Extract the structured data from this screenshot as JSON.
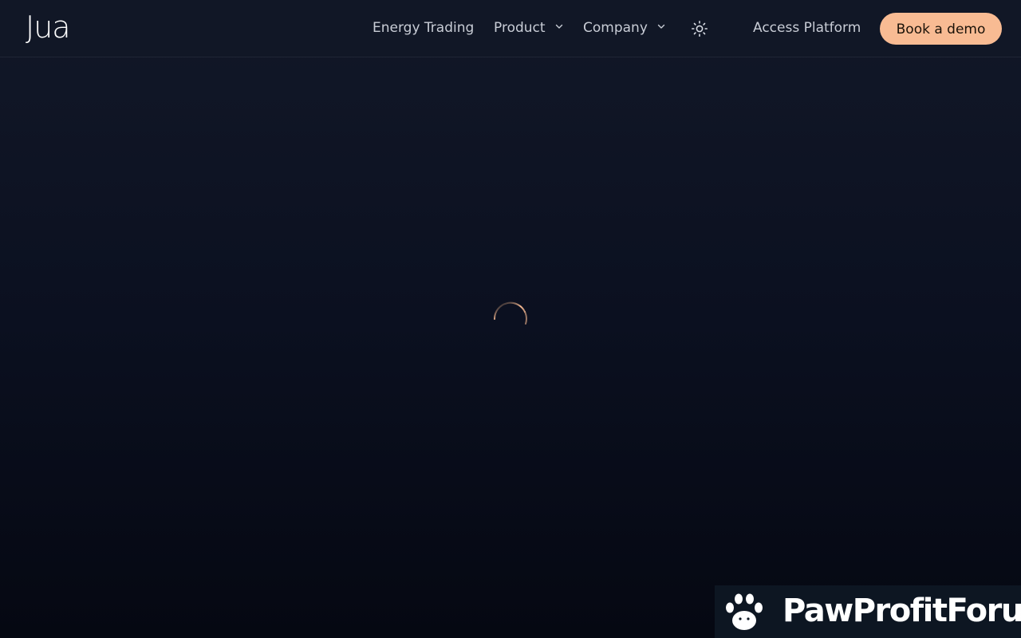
{
  "header": {
    "logo_text": "Jua",
    "nav": {
      "energy_trading": "Energy Trading",
      "product": "Product",
      "company": "Company",
      "access_platform": "Access Platform"
    },
    "cta_label": "Book a demo",
    "icons": {
      "theme_toggle": "sun-icon",
      "dropdown": "chevron-down-icon"
    }
  },
  "main": {
    "loading_indicator": "spinner-icon"
  },
  "watermark": {
    "text": "PawProfitForum",
    "icon": "paw-icon"
  },
  "colors": {
    "background": "#0b1020",
    "accent": "#f8bb93",
    "nav_text": "#c9cdd6"
  }
}
